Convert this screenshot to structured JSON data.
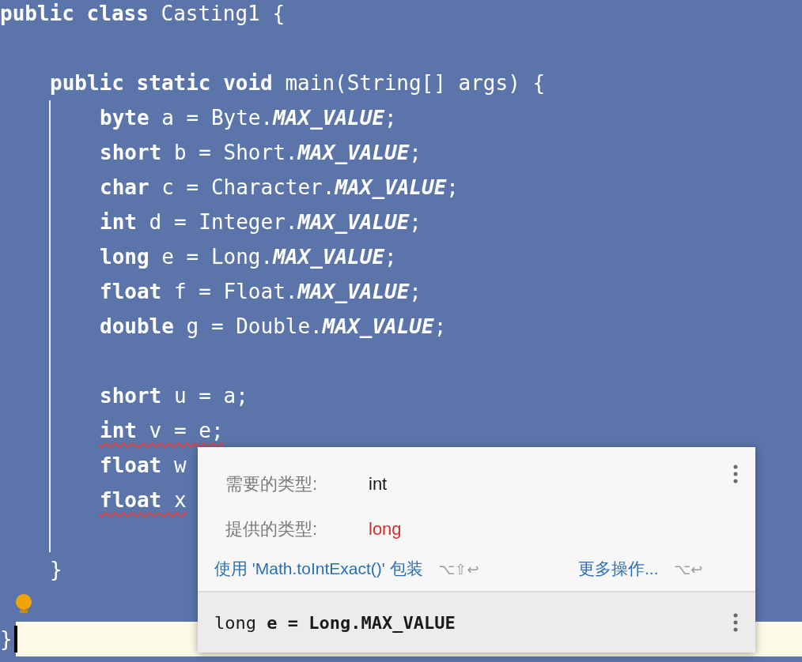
{
  "editor": {
    "lines": [
      {
        "kind": "code",
        "current": false,
        "squiggle": false,
        "tokens": [
          {
            "kind": "keyword",
            "text": "public class"
          },
          {
            "kind": "plain",
            "text": " Casting1 {"
          }
        ],
        "children": [
          {
            "kind": "blank",
            "current": false
          },
          {
            "kind": "code",
            "current": false,
            "squiggle": false,
            "tokens": [
              {
                "kind": "keyword",
                "text": "public static void"
              },
              {
                "kind": "plain",
                "text": " main(String[] args) {"
              }
            ],
            "children": [
              {
                "kind": "code",
                "current": false,
                "squiggle": false,
                "tokens": [
                  {
                    "kind": "keyword",
                    "text": "byte"
                  },
                  {
                    "kind": "plain",
                    "text": " a = Byte."
                  },
                  {
                    "kind": "constant",
                    "text": "MAX_VALUE"
                  },
                  {
                    "kind": "plain",
                    "text": ";"
                  }
                ]
              },
              {
                "kind": "code",
                "current": false,
                "squiggle": false,
                "tokens": [
                  {
                    "kind": "keyword",
                    "text": "short"
                  },
                  {
                    "kind": "plain",
                    "text": " b = Short."
                  },
                  {
                    "kind": "constant",
                    "text": "MAX_VALUE"
                  },
                  {
                    "kind": "plain",
                    "text": ";"
                  }
                ]
              },
              {
                "kind": "code",
                "current": false,
                "squiggle": false,
                "tokens": [
                  {
                    "kind": "keyword",
                    "text": "char"
                  },
                  {
                    "kind": "plain",
                    "text": " c = Character."
                  },
                  {
                    "kind": "constant",
                    "text": "MAX_VALUE"
                  },
                  {
                    "kind": "plain",
                    "text": ";"
                  }
                ]
              },
              {
                "kind": "code",
                "current": false,
                "squiggle": false,
                "tokens": [
                  {
                    "kind": "keyword",
                    "text": "int"
                  },
                  {
                    "kind": "plain",
                    "text": " d = Integer."
                  },
                  {
                    "kind": "constant",
                    "text": "MAX_VALUE"
                  },
                  {
                    "kind": "plain",
                    "text": ";"
                  }
                ]
              },
              {
                "kind": "code",
                "current": false,
                "squiggle": false,
                "tokens": [
                  {
                    "kind": "keyword",
                    "text": "long"
                  },
                  {
                    "kind": "plain",
                    "text": " e = Long."
                  },
                  {
                    "kind": "constant",
                    "text": "MAX_VALUE"
                  },
                  {
                    "kind": "plain",
                    "text": ";"
                  }
                ]
              },
              {
                "kind": "code",
                "current": false,
                "squiggle": false,
                "tokens": [
                  {
                    "kind": "keyword",
                    "text": "float"
                  },
                  {
                    "kind": "plain",
                    "text": " f = Float."
                  },
                  {
                    "kind": "constant",
                    "text": "MAX_VALUE"
                  },
                  {
                    "kind": "plain",
                    "text": ";"
                  }
                ]
              },
              {
                "kind": "code",
                "current": false,
                "squiggle": false,
                "tokens": [
                  {
                    "kind": "keyword",
                    "text": "double"
                  },
                  {
                    "kind": "plain",
                    "text": " g = Double."
                  },
                  {
                    "kind": "constant",
                    "text": "MAX_VALUE"
                  },
                  {
                    "kind": "plain",
                    "text": ";"
                  }
                ]
              },
              {
                "kind": "blank",
                "current": false
              },
              {
                "kind": "code",
                "current": false,
                "squiggle": false,
                "tokens": [
                  {
                    "kind": "keyword",
                    "text": "short"
                  },
                  {
                    "kind": "plain",
                    "text": " u = a;"
                  }
                ]
              },
              {
                "kind": "code",
                "current": false,
                "squiggle": true,
                "tokens": [
                  {
                    "kind": "keyword",
                    "text": "int"
                  },
                  {
                    "kind": "plain",
                    "text": " v = e;"
                  }
                ]
              },
              {
                "kind": "code",
                "current": false,
                "squiggle": false,
                "tokens": [
                  {
                    "kind": "keyword",
                    "text": "float"
                  },
                  {
                    "kind": "plain",
                    "text": " w"
                  }
                ]
              },
              {
                "kind": "code",
                "current": false,
                "squiggle": true,
                "tokens": [
                  {
                    "kind": "keyword",
                    "text": "float"
                  },
                  {
                    "kind": "plain",
                    "text": " x"
                  }
                ]
              },
              {
                "kind": "blank",
                "current": false
              }
            ]
          },
          {
            "kind": "code",
            "current": false,
            "squiggle": false,
            "tokens": [
              {
                "kind": "plain",
                "text": "}"
              }
            ]
          }
        ]
      },
      {
        "kind": "blank",
        "current": false,
        "bulb": true
      },
      {
        "kind": "code",
        "current": true,
        "squiggle": false,
        "tokens": [
          {
            "kind": "plain",
            "text": "}"
          }
        ]
      }
    ]
  },
  "popup": {
    "rows": [
      {
        "label": "需要的类型:",
        "value": "int",
        "kind": "expected"
      },
      {
        "label": "提供的类型:",
        "value": "long",
        "kind": "error"
      }
    ],
    "actions": [
      {
        "label": "使用 'Math.toIntExact()' 包装",
        "shortcut": "⌥⇧↩"
      },
      {
        "label": "更多操作...",
        "shortcut": "⌥↩"
      }
    ],
    "declaration": "long **e = Long.MAX_VALUE**"
  }
}
